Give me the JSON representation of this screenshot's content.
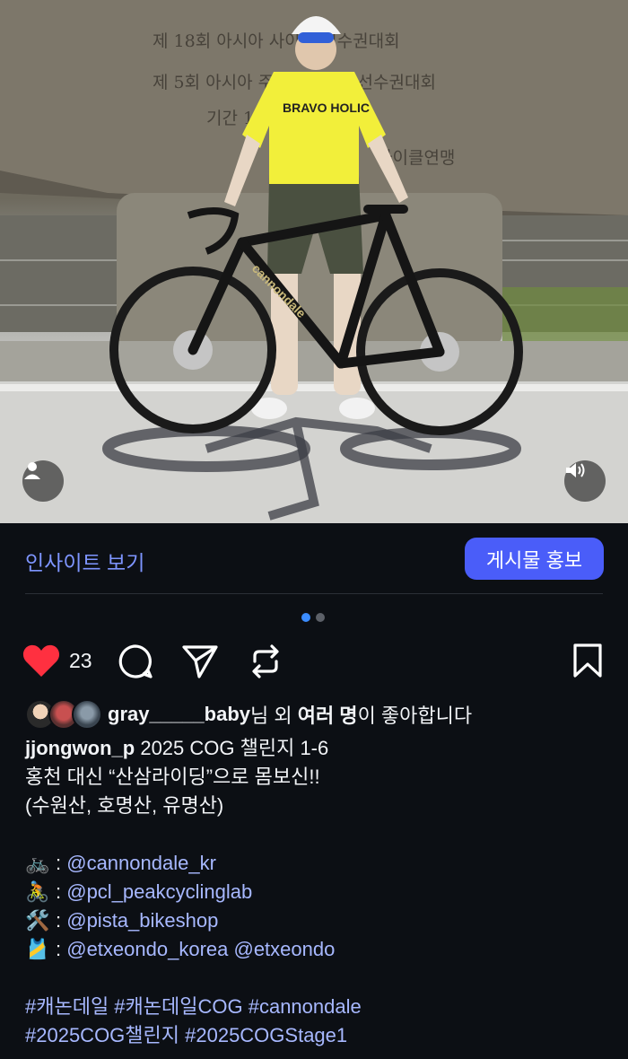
{
  "post": {
    "insights_label": "인사이트 보기",
    "promote_label": "게시물 홍보",
    "carousel": {
      "count": 2,
      "active": 0
    },
    "like_count": "23",
    "liked_by": {
      "username": "gray_____baby",
      "suffix_1": "님 외 ",
      "others_bold": "여러 명",
      "suffix_2": "이 좋아합니다"
    },
    "caption": {
      "author": "jjongwon_p",
      "line1_text": "2025 COG 챌린지 1-6",
      "line2": "홍천 대신 “산삼라이딩”으로 몸보신!!",
      "line3": "(수원산, 호명산, 유명산)",
      "credits": [
        {
          "emoji": "🚲",
          "sep": ": ",
          "mentions": [
            "@cannondale_kr"
          ]
        },
        {
          "emoji": "🚴",
          "sep": ": ",
          "mentions": [
            "@pcl_peakcyclinglab"
          ]
        },
        {
          "emoji": "🛠️",
          "sep": ": ",
          "mentions": [
            "@pista_bikeshop"
          ]
        },
        {
          "emoji": "🎽",
          "sep": ": ",
          "mentions": [
            "@etxeondo_korea",
            "@etxeondo"
          ]
        }
      ],
      "hashtags_line1": "#캐논데일 #캐논데일COG #cannondale",
      "hashtags_line2": "#2025COG챌린지 #2025COGStage1"
    },
    "photo": {
      "sign_lines": [
        "제 18회 아시아 사이클 선수권대회",
        "제 5회 아시아 주니어사이클 선수권대회",
        "기간 1997.9.6",
        "사이클연맹"
      ],
      "jersey_text": "BRAVO HOLIC",
      "frame_text": "cannondale"
    }
  },
  "colors": {
    "accent": "#4a5df9",
    "link": "#a7b8ff",
    "heart": "#ff3040",
    "background": "#0c0f14"
  },
  "icons": {
    "like": "heart-filled-icon",
    "comment": "comment-bubble-icon",
    "share": "paper-plane-icon",
    "repost": "repost-icon",
    "save": "bookmark-icon",
    "tags": "user-tag-icon",
    "sound": "speaker-icon"
  }
}
